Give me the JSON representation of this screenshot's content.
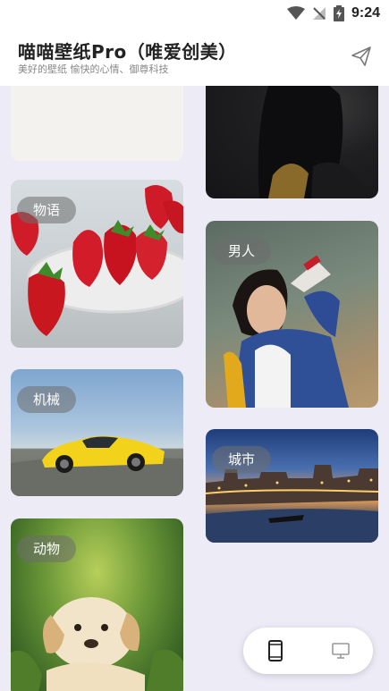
{
  "status_bar": {
    "time": "9:24"
  },
  "app_bar": {
    "title": "喵喵壁纸Pro（唯爱创美）",
    "subtitle": "美好的壁纸 愉快的心情、御尊科技",
    "send_icon": "send-icon"
  },
  "feed": {
    "cards": [
      {
        "tag": ""
      },
      {
        "tag": ""
      },
      {
        "tag": "物语"
      },
      {
        "tag": "男人"
      },
      {
        "tag": "机械"
      },
      {
        "tag": "城市"
      },
      {
        "tag": "动物"
      }
    ]
  },
  "view_toggle": {
    "phone_icon": "phone-icon",
    "desktop_icon": "desktop-icon",
    "selected": "phone"
  }
}
